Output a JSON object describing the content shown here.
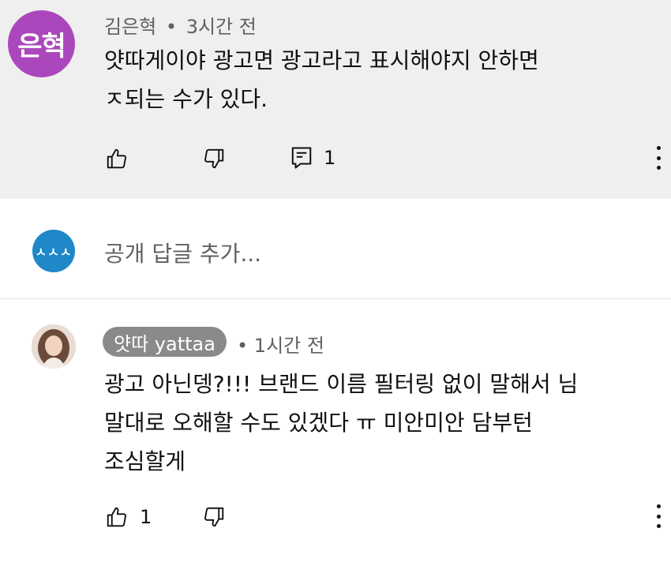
{
  "comment": {
    "avatar_text": "은혁",
    "author": "김은혁",
    "time": "3시간 전",
    "separator": "•",
    "text": "얏따게이야 광고면 광고라고 표시해야지 안하면\nㅈ되는 수가 있다.",
    "reply_count": "1"
  },
  "reply_box": {
    "avatar_text": "ㅅㅅㅅ",
    "placeholder": "공개 답글 추가..."
  },
  "reply": {
    "author": "얏따 yattaa",
    "time": "1시간 전",
    "separator": "•",
    "text": "광고 아닌뎅?!!! 브랜드 이름 필터링 없이 말해서 님\n말대로 오해할 수도 있겠다 ㅠ 미안미안 담부턴\n조심할게",
    "like_count": "1"
  },
  "colors": {
    "top_background": "#efefef",
    "avatar_purple": "#ab47bc",
    "avatar_blue": "#1e88c8",
    "author_chip": "#8a8a8a"
  },
  "icons": [
    "thumbs-up-icon",
    "thumbs-down-icon",
    "reply-icon",
    "more-vert-icon"
  ]
}
